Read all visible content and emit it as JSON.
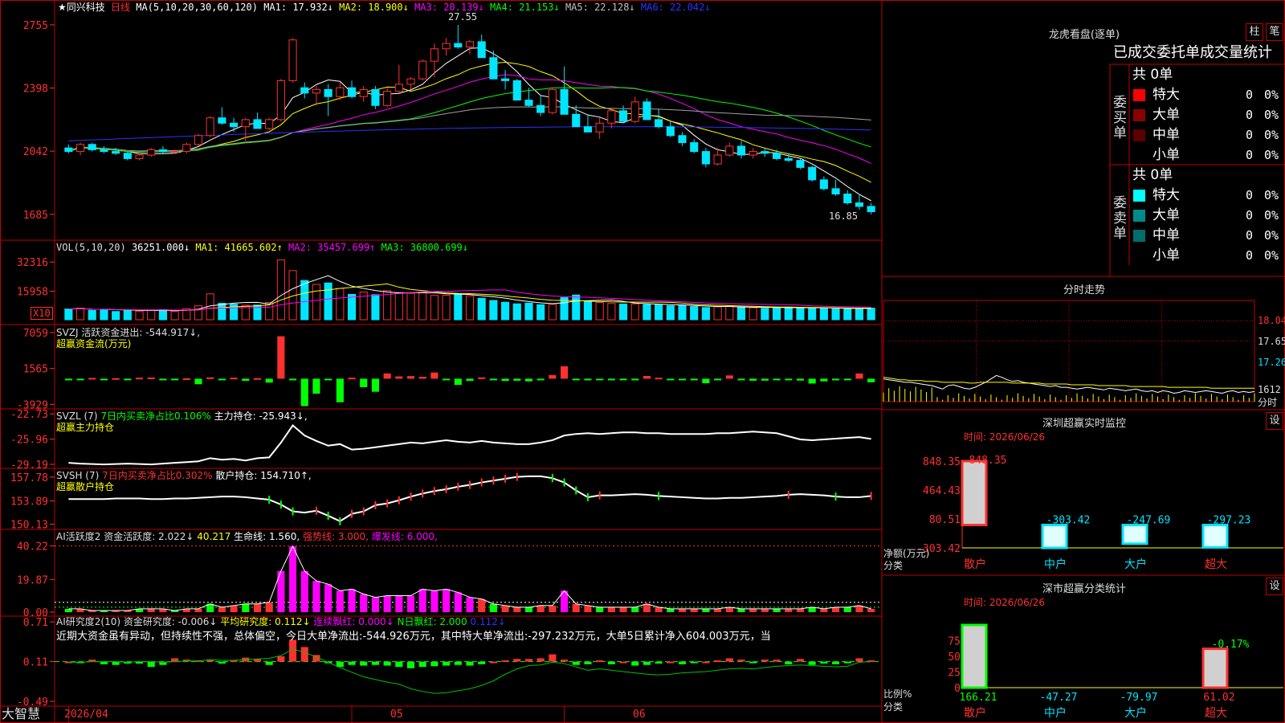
{
  "stock": {
    "name": "★同兴科技",
    "period": "日线"
  },
  "colors": {
    "bg": "#000000",
    "grid": "#c00000",
    "up": "#ff3030",
    "down": "#00e5ff",
    "white": "#ffffff",
    "yellow": "#ffff00",
    "magenta": "#ff00ff",
    "green": "#00ff00",
    "blue": "#3030ff",
    "gray": "#a0a0a0"
  },
  "kline": {
    "legend": {
      "ma": "MA(5,10,20,30,60,120)",
      "ma1": "MA1: 17.932↓",
      "ma2": "MA2: 18.900↓",
      "ma3": "MA3: 20.139↓",
      "ma4": "MA4: 21.153↓",
      "ma5": "MA5: 22.128↓",
      "ma6": "MA6: 22.042↓"
    },
    "y_ticks": [
      "27.55",
      "23.98",
      "20.42",
      "16.85"
    ],
    "high_label": "27.55",
    "low_label": "16.85",
    "y_range": [
      15.8,
      28.5
    ],
    "candles": [
      [
        20.6,
        20.8,
        20.3,
        20.4
      ],
      [
        20.4,
        20.9,
        20.2,
        20.8
      ],
      [
        20.8,
        20.9,
        20.4,
        20.5
      ],
      [
        20.5,
        20.7,
        20.3,
        20.4
      ],
      [
        20.4,
        20.6,
        20.2,
        20.3
      ],
      [
        20.3,
        20.4,
        19.9,
        20.0
      ],
      [
        20.0,
        20.3,
        19.9,
        20.2
      ],
      [
        20.2,
        20.6,
        20.1,
        20.5
      ],
      [
        20.5,
        20.7,
        20.3,
        20.4
      ],
      [
        20.4,
        20.5,
        20.3,
        20.4
      ],
      [
        20.4,
        20.9,
        20.3,
        20.8
      ],
      [
        20.8,
        21.4,
        20.7,
        21.3
      ],
      [
        21.3,
        22.4,
        21.2,
        22.3
      ],
      [
        22.3,
        22.9,
        21.9,
        22.0
      ],
      [
        22.0,
        22.3,
        21.5,
        21.8
      ],
      [
        21.8,
        22.3,
        21.0,
        22.2
      ],
      [
        22.2,
        22.6,
        21.8,
        21.7
      ],
      [
        21.7,
        22.3,
        21.6,
        22.2
      ],
      [
        22.2,
        24.5,
        22.1,
        24.4
      ],
      [
        24.4,
        26.8,
        24.3,
        26.7
      ],
      [
        24.0,
        24.3,
        23.4,
        23.7
      ],
      [
        23.7,
        24.1,
        23.0,
        23.9
      ],
      [
        23.9,
        24.2,
        22.4,
        23.5
      ],
      [
        23.5,
        24.3,
        23.3,
        24.0
      ],
      [
        24.0,
        24.4,
        23.4,
        23.5
      ],
      [
        23.5,
        24.1,
        23.2,
        23.9
      ],
      [
        23.9,
        24.1,
        22.8,
        23.0
      ],
      [
        23.0,
        24.0,
        22.9,
        23.8
      ],
      [
        23.8,
        25.3,
        23.7,
        24.2
      ],
      [
        24.2,
        24.6,
        23.9,
        24.5
      ],
      [
        24.5,
        25.6,
        24.4,
        25.5
      ],
      [
        25.5,
        26.5,
        24.6,
        26.2
      ],
      [
        26.2,
        26.8,
        25.8,
        26.5
      ],
      [
        26.5,
        27.55,
        26.2,
        26.3
      ],
      [
        26.3,
        26.7,
        25.9,
        26.6
      ],
      [
        26.6,
        27.0,
        26.0,
        25.7
      ],
      [
        25.7,
        26.1,
        24.8,
        24.5
      ],
      [
        24.5,
        25.0,
        23.9,
        24.4
      ],
      [
        24.4,
        24.5,
        23.3,
        23.3
      ],
      [
        23.3,
        24.0,
        22.9,
        23.0
      ],
      [
        23.0,
        23.6,
        22.4,
        22.6
      ],
      [
        22.6,
        24.0,
        22.5,
        23.9
      ],
      [
        23.9,
        25.2,
        23.7,
        22.5
      ],
      [
        22.5,
        23.0,
        21.9,
        21.8
      ],
      [
        21.8,
        22.5,
        21.6,
        21.5
      ],
      [
        21.5,
        22.3,
        21.1,
        22.0
      ],
      [
        22.0,
        22.8,
        21.7,
        22.7
      ],
      [
        22.7,
        23.0,
        22.0,
        22.1
      ],
      [
        22.1,
        23.5,
        22.0,
        23.2
      ],
      [
        23.2,
        23.4,
        22.3,
        22.2
      ],
      [
        22.2,
        22.8,
        21.7,
        21.8
      ],
      [
        21.8,
        22.1,
        21.2,
        21.3
      ],
      [
        21.3,
        21.5,
        20.7,
        20.9
      ],
      [
        20.9,
        21.1,
        20.3,
        20.4
      ],
      [
        20.4,
        20.6,
        19.5,
        19.7
      ],
      [
        19.7,
        20.6,
        19.6,
        20.2
      ],
      [
        20.2,
        20.9,
        20.1,
        20.7
      ],
      [
        20.7,
        21.0,
        20.0,
        20.2
      ],
      [
        20.2,
        20.6,
        20.0,
        20.4
      ],
      [
        20.4,
        20.6,
        20.1,
        20.3
      ],
      [
        20.3,
        20.5,
        19.9,
        20.0
      ],
      [
        20.0,
        20.3,
        19.8,
        19.9
      ],
      [
        19.9,
        20.0,
        19.4,
        19.5
      ],
      [
        19.5,
        19.6,
        18.7,
        18.8
      ],
      [
        18.8,
        19.0,
        18.2,
        18.3
      ],
      [
        18.3,
        18.8,
        17.9,
        18.0
      ],
      [
        18.0,
        18.2,
        17.4,
        17.5
      ],
      [
        17.5,
        18.0,
        17.1,
        17.3
      ],
      [
        17.3,
        17.5,
        16.85,
        17.0
      ]
    ]
  },
  "vol": {
    "legend": "VOL(5,10,20)",
    "value": "36251.000↓",
    "ma1": "MA1: 41665.602↑",
    "ma2": "MA2: 35457.699↑",
    "ma3": "MA3: 36800.699↓",
    "y_ticks": [
      "32316",
      "15958"
    ],
    "unit": "X10",
    "max": 36000,
    "values": [
      6000,
      6500,
      5200,
      5800,
      4600,
      5400,
      4800,
      5200,
      5600,
      4700,
      6200,
      7800,
      14500,
      9200,
      8700,
      8100,
      8200,
      9600,
      33500,
      27500,
      22000,
      19800,
      20600,
      17500,
      14200,
      15500,
      14000,
      16300,
      15200,
      14800,
      15400,
      13600,
      13700,
      14500,
      13400,
      12000,
      10800,
      9800,
      8900,
      9300,
      8400,
      8600,
      12400,
      13800,
      10200,
      9700,
      9100,
      8800,
      8900,
      8500,
      8300,
      7800,
      8000,
      7400,
      6800,
      7200,
      7600,
      6800,
      6700,
      6400,
      6800,
      7100,
      6700,
      6500,
      6300,
      6200,
      6100,
      6400,
      6500
    ]
  },
  "svzj": {
    "legend": "SVZJ 活跃资金进出: -544.917↓,",
    "sub": "超赢资金流(万元)",
    "y_ticks": [
      "7059",
      "1565",
      "-3929"
    ],
    "range": [
      -4500,
      7800
    ],
    "values": [
      -100,
      -150,
      120,
      -120,
      80,
      -200,
      150,
      180,
      -100,
      -120,
      60,
      -850,
      200,
      -200,
      150,
      -320,
      80,
      -600,
      6500,
      -160,
      -4200,
      -2300,
      -50,
      -3600,
      150,
      -1300,
      -2000,
      800,
      350,
      400,
      300,
      950,
      -70,
      -950,
      -340,
      200,
      -170,
      -340,
      -300,
      -400,
      -240,
      560,
      1900,
      -180,
      -50,
      -120,
      -170,
      -210,
      -240,
      420,
      150,
      -140,
      -220,
      -160,
      -690,
      -130,
      500,
      -60,
      -300,
      -290,
      -120,
      -110,
      -280,
      -740,
      -400,
      -250,
      -220,
      800,
      -545
    ]
  },
  "svzl": {
    "legend": "SVZL (7)",
    "label1": "7日内买卖净占比0.106%",
    "label2": "主力持仓: -25.943↓,",
    "sub": "超赢主力持仓",
    "y_ticks": [
      "-22.73",
      "-25.96",
      "-29.19"
    ],
    "range": [
      -29.6,
      -22.4
    ],
    "values": [
      -29.0,
      -29.1,
      -29.15,
      -29.2,
      -29.15,
      -29.1,
      -29.15,
      -29.2,
      -29.1,
      -29.0,
      -28.9,
      -28.8,
      -28.4,
      -28.6,
      -28.5,
      -28.7,
      -28.4,
      -28.3,
      -26.4,
      -24.2,
      -25.5,
      -26.2,
      -26.8,
      -26.6,
      -27.3,
      -27.2,
      -27.0,
      -26.8,
      -26.6,
      -26.4,
      -26.5,
      -26.3,
      -26.1,
      -26.3,
      -26.4,
      -26.2,
      -26.4,
      -26.5,
      -26.6,
      -26.6,
      -26.4,
      -26.1,
      -25.5,
      -25.3,
      -25.2,
      -25.3,
      -25.2,
      -25.1,
      -25.1,
      -25.2,
      -25.2,
      -25.3,
      -25.3,
      -25.3,
      -25.3,
      -25.2,
      -25.2,
      -25.1,
      -25.0,
      -25.1,
      -25.2,
      -25.6,
      -26.0,
      -26.1,
      -26.0,
      -25.9,
      -25.8,
      -25.7,
      -25.94
    ]
  },
  "svsh": {
    "legend": "SVSH (7)",
    "label1": "7日内买卖净占比0.302%",
    "label2": "散户持仓: 154.710↑,",
    "sub": "超赢散户持仓",
    "y_ticks": [
      "157.78",
      "153.89",
      "150.13"
    ],
    "range": [
      149.4,
      158.8
    ],
    "values": [
      154.2,
      154.2,
      154.2,
      154.2,
      154.3,
      154.3,
      154.3,
      154.2,
      154.2,
      154.3,
      154.3,
      154.4,
      154.5,
      154.6,
      154.6,
      154.5,
      154.3,
      154.1,
      153.3,
      152.2,
      152.0,
      152.3,
      151.5,
      150.6,
      151.8,
      152.2,
      153.2,
      153.5,
      154.0,
      154.6,
      155.1,
      155.5,
      155.8,
      156.2,
      156.5,
      156.9,
      157.2,
      157.5,
      157.8,
      157.9,
      157.9,
      157.6,
      156.9,
      155.6,
      154.5,
      154.8,
      154.8,
      154.9,
      155.0,
      154.9,
      154.7,
      154.6,
      154.5,
      154.4,
      154.3,
      154.3,
      154.4,
      154.4,
      154.5,
      154.6,
      154.7,
      154.9,
      155.0,
      154.9,
      154.8,
      154.6,
      154.5,
      154.5,
      154.71
    ]
  },
  "ai_act": {
    "legend": "AI活跃度2 资金活跃度: 2.022↓",
    "v1": "40.217",
    "v2": "生命线: 1.560,",
    "v3": "强势线: 3.000,",
    "v4": "爆发线: 6.000,",
    "y_ticks": [
      "40.22",
      "19.87",
      "0.00"
    ],
    "max": 42,
    "values": [
      2,
      2,
      1,
      1,
      1,
      1,
      2,
      2,
      2,
      1,
      2,
      2,
      5,
      3,
      4,
      5,
      5,
      6,
      25,
      40,
      25,
      19,
      17,
      13,
      14,
      11,
      9,
      10,
      10,
      10,
      14,
      13,
      14,
      12,
      9,
      8,
      5,
      4,
      3,
      3,
      4,
      4,
      13,
      5,
      4,
      3,
      3,
      3,
      3,
      5,
      3,
      2,
      2,
      2,
      2,
      2,
      3,
      2,
      2,
      2,
      2,
      2,
      2,
      3,
      2,
      3,
      3,
      4,
      2
    ]
  },
  "ai_res": {
    "legend": "AI研究度2(10) 资金研究度: -0.006↓",
    "v1": "平均研究度: 0.112↓",
    "v2": "连续飘红: 0.000↓",
    "v3": "N日飘红: 2.000",
    "v4": "0.112↓",
    "y_ticks": [
      "0.71",
      "0.11",
      "-0.49"
    ],
    "range": [
      -0.55,
      0.76
    ],
    "message": "近期大资金虽有异动，但持续性不强，总体偏空，今日大单净流出:-544.926万元，其中特大单净流出:-297.232万元，大单5日累计净入604.003万元，当",
    "bars": [
      0.0,
      -0.02,
      0.03,
      -0.04,
      -0.05,
      -0.03,
      -0.03,
      -0.08,
      -0.05,
      0.05,
      0.03,
      0.02,
      0.03,
      -0.03,
      0.02,
      0.06,
      0.04,
      -0.05,
      0.08,
      0.33,
      0.22,
      0.1,
      -0.02,
      -0.08,
      -0.05,
      -0.06,
      -0.05,
      -0.06,
      -0.08,
      -0.1,
      -0.08,
      -0.07,
      -0.06,
      -0.05,
      -0.06,
      -0.04,
      0.0,
      0.02,
      0.04,
      0.04,
      0.05,
      0.11,
      0.03,
      -0.05,
      -0.04,
      0.02,
      -0.04,
      0.0,
      -0.06,
      -0.05,
      -0.03,
      0.0,
      -0.04,
      -0.02,
      0.0,
      0.02,
      0.05,
      0.03,
      -0.02,
      0.03,
      0.03,
      -0.04,
      0.04,
      -0.05,
      -0.03,
      -0.04,
      -0.02,
      0.05,
      0.02
    ],
    "line": [
      0.1,
      0.1,
      0.11,
      0.11,
      0.11,
      0.1,
      0.11,
      0.11,
      0.1,
      0.11,
      0.12,
      0.12,
      0.14,
      0.13,
      0.13,
      0.14,
      0.15,
      0.16,
      0.2,
      0.3,
      0.25,
      0.18,
      0.1,
      0.02,
      -0.05,
      -0.12,
      -0.16,
      -0.2,
      -0.23,
      -0.3,
      -0.34,
      -0.37,
      -0.36,
      -0.33,
      -0.3,
      -0.25,
      -0.18,
      -0.08,
      0.0,
      0.05,
      0.06,
      0.1,
      0.08,
      0.03,
      -0.02,
      0.0,
      -0.02,
      -0.04,
      -0.06,
      -0.08,
      -0.09,
      -0.08,
      -0.06,
      -0.05,
      -0.04,
      -0.02,
      0.0,
      0.01,
      0.0,
      0.02,
      0.04,
      0.05,
      0.06,
      0.05,
      0.04,
      0.03,
      0.04,
      0.1,
      0.11
    ],
    "dates": [
      "2026/04",
      "05",
      "06"
    ]
  },
  "footer": {
    "brand": "大智慧"
  },
  "longhu": {
    "title": "龙虎看盘(逐单)",
    "btn1": "柱",
    "btn2": "笔",
    "subtitle": "已成交委托单成交量统计",
    "buy": {
      "side": "委买单",
      "total": "共 0单",
      "rows": [
        {
          "name": "特大",
          "v": "0",
          "p": "0%",
          "color": "#ff0000"
        },
        {
          "name": "大单",
          "v": "0",
          "p": "0%",
          "color": "#8b0000"
        },
        {
          "name": "中单",
          "v": "0",
          "p": "0%",
          "color": "#5a0000"
        },
        {
          "name": "小单",
          "v": "0",
          "p": "0%",
          "color": "#000000"
        }
      ]
    },
    "sell": {
      "side": "委卖单",
      "total": "共 0单",
      "rows": [
        {
          "name": "特大",
          "v": "0",
          "p": "0%",
          "color": "#00ffff"
        },
        {
          "name": "大单",
          "v": "0",
          "p": "0%",
          "color": "#008b8b"
        },
        {
          "name": "中单",
          "v": "0",
          "p": "0%",
          "color": "#006d6d"
        },
        {
          "name": "小单",
          "v": "0",
          "p": "0%",
          "color": "#000000"
        }
      ]
    }
  },
  "fenshi": {
    "title": "分时走势",
    "y_ticks": [
      "18.04",
      "17.65",
      "17.26"
    ],
    "vol_label": "1612",
    "foot": "分时",
    "price": [
      17.22,
      17.21,
      17.2,
      17.19,
      17.18,
      17.18,
      17.17,
      17.16,
      17.15,
      17.14,
      17.12,
      17.1,
      17.14,
      17.15,
      17.13,
      17.11,
      17.1,
      17.12,
      17.15,
      17.18,
      17.22,
      17.26,
      17.24,
      17.21,
      17.19,
      17.2,
      17.18,
      17.17,
      17.16,
      17.15,
      17.14,
      17.13,
      17.14,
      17.12,
      17.12,
      17.11,
      17.1,
      17.11,
      17.12,
      17.11,
      17.1,
      17.09,
      17.11,
      17.1,
      17.09,
      17.08,
      17.09,
      17.1,
      17.08,
      17.07,
      17.08,
      17.06,
      17.08,
      17.07,
      17.05,
      17.06,
      17.08,
      17.07,
      17.06,
      17.07,
      17.08,
      17.07,
      17.06,
      17.05,
      17.07,
      17.08,
      17.06,
      17.07,
      17.06,
      17.07
    ],
    "avg": [
      17.24,
      17.23,
      17.22,
      17.21,
      17.21,
      17.2,
      17.2,
      17.2,
      17.19,
      17.19,
      17.19,
      17.18,
      17.18,
      17.18,
      17.18,
      17.18,
      17.17,
      17.17,
      17.18,
      17.18,
      17.18,
      17.18,
      17.18,
      17.18,
      17.17,
      17.17,
      17.17,
      17.17,
      17.17,
      17.17,
      17.16,
      17.16,
      17.16,
      17.16,
      17.16,
      17.15,
      17.15,
      17.15,
      17.15,
      17.15,
      17.14,
      17.14,
      17.14,
      17.14,
      17.14,
      17.14,
      17.13,
      17.13,
      17.13,
      17.13,
      17.13,
      17.13,
      17.13,
      17.12,
      17.12,
      17.12,
      17.12,
      17.12,
      17.12,
      17.12,
      17.12,
      17.11,
      17.11,
      17.11,
      17.11,
      17.11,
      17.11,
      17.11,
      17.11,
      17.11
    ],
    "range": [
      16.95,
      18.15
    ]
  },
  "sz_monitor": {
    "title": "深圳超赢实时监控",
    "btn": "设",
    "date": "时间: 2026/06/26",
    "y_ticks": [
      "848.35",
      "464.43",
      "80.51",
      "-303.42"
    ],
    "ylabel": "净额(万元)",
    "xlabel": "分类",
    "range": [
      -303.42,
      848.35
    ],
    "bars": [
      {
        "cat": "散户",
        "v": 848.35,
        "label": "848.35"
      },
      {
        "cat": "中户",
        "v": -303.42,
        "label": "-303.42"
      },
      {
        "cat": "大户",
        "v": -247.69,
        "label": "-247.69"
      },
      {
        "cat": "超大",
        "v": -297.23,
        "label": "-297.23"
      }
    ]
  },
  "sz_class": {
    "title": "深市超赢分类统计",
    "btn": "设",
    "date": "时间: 2026/06/26",
    "y_ticks": [
      "75",
      "50",
      "25",
      "0"
    ],
    "ylabel": "比例%",
    "xlabel": "分类",
    "pct_label": "-0.17%",
    "bars": [
      {
        "cat": "散户",
        "v": 100,
        "label": "166.21"
      },
      {
        "cat": "中户",
        "v": 0,
        "label": "-47.27"
      },
      {
        "cat": "大户",
        "v": 0,
        "label": "-79.97"
      },
      {
        "cat": "超大",
        "v": 62,
        "label": "61.02"
      }
    ]
  }
}
